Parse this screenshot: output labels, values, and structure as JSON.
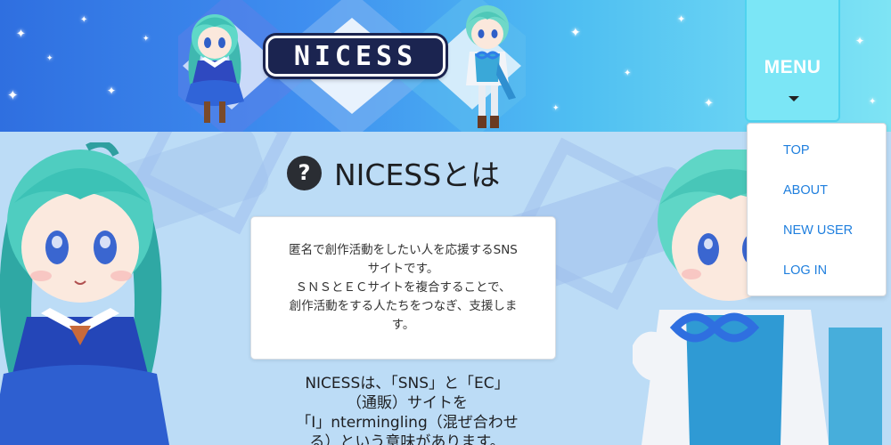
{
  "header": {
    "logo_text": "NICESS",
    "menu_label": "MENU"
  },
  "menu": {
    "items": [
      {
        "label": "TOP"
      },
      {
        "label": "ABOUT"
      },
      {
        "label": "NEW USER"
      },
      {
        "label": "LOG IN"
      }
    ]
  },
  "main": {
    "title": "NICESSとは",
    "info_lines": [
      "匿名で創作活動をしたい人を応援するSNS",
      "サイトです。",
      "ＳＮＳとＥＣサイトを複合することで、",
      "創作活動をする人たちをつなぎ、支援しま",
      "す。"
    ],
    "description_lines": [
      "NICESSは、「SNS」と「EC」",
      "（通販）サイトを",
      "「I」ntermingling（混ぜ合わせ",
      "る）という意味があります。"
    ]
  },
  "icons": {
    "question": "question-icon",
    "caret": "caret-down-icon"
  },
  "colors": {
    "header_start": "#2f6fe0",
    "header_end": "#7ee4f4",
    "menu_button": "#7be6f6",
    "menu_link": "#1f7fde",
    "page_bg": "#bcdcf6"
  }
}
